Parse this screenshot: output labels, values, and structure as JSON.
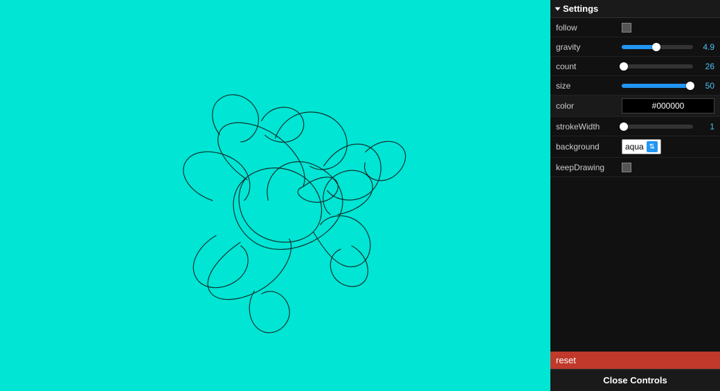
{
  "settings": {
    "title": "Settings",
    "rows": [
      {
        "label": "follow",
        "type": "checkbox",
        "checked": false
      },
      {
        "label": "gravity",
        "type": "slider",
        "value": 4.9,
        "min": 0,
        "max": 10,
        "fillPct": 49
      },
      {
        "label": "count",
        "type": "slider",
        "value": 26,
        "min": 0,
        "max": 100,
        "fillPct": 3
      },
      {
        "label": "size",
        "type": "slider",
        "value": 50,
        "min": 0,
        "max": 100,
        "fillPct": 96
      },
      {
        "label": "color",
        "type": "color",
        "value": "#000000",
        "display": "#000000"
      },
      {
        "label": "strokeWidth",
        "type": "slider",
        "value": 1,
        "min": 0,
        "max": 10,
        "fillPct": 3
      },
      {
        "label": "background",
        "type": "select",
        "value": "aqua"
      },
      {
        "label": "keepDrawing",
        "type": "checkbox",
        "checked": false
      }
    ],
    "reset_label": "reset",
    "close_label": "Close Controls"
  }
}
